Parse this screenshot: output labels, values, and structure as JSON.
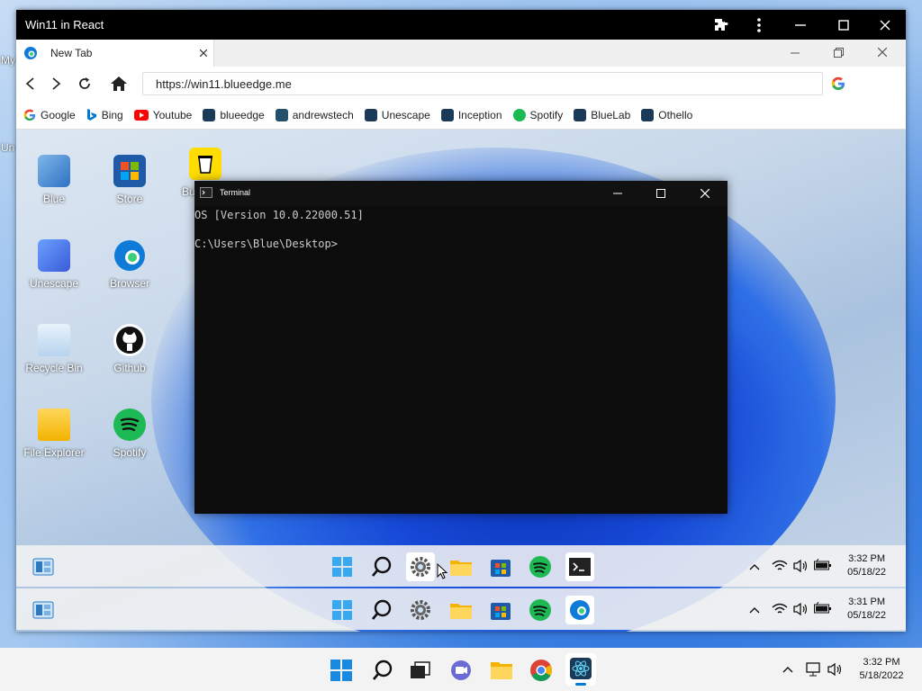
{
  "outer_desktop": {
    "side_labels": [
      "My",
      "Un"
    ]
  },
  "browser": {
    "window_title": "Win11 in React",
    "tab": {
      "label": "New Tab"
    },
    "url": "https://win11.blueedge.me",
    "bookmarks": [
      {
        "label": "Google",
        "color": "#4285F4"
      },
      {
        "label": "Bing",
        "color": "#0078D4"
      },
      {
        "label": "Youtube",
        "color": "#FF0000"
      },
      {
        "label": "blueedge",
        "color": "#1b3a57"
      },
      {
        "label": "andrewstech",
        "color": "#24506b"
      },
      {
        "label": "Unescape",
        "color": "#1b3a57"
      },
      {
        "label": "Inception",
        "color": "#1b3a57"
      },
      {
        "label": "Spotify",
        "color": "#1DB954"
      },
      {
        "label": "BlueLab",
        "color": "#1b3a57"
      },
      {
        "label": "Othello",
        "color": "#1b3a57"
      }
    ]
  },
  "inner_desktop": {
    "icons": [
      {
        "label": "Blue",
        "icon": "user-pc-icon"
      },
      {
        "label": "Store",
        "icon": "store-icon"
      },
      {
        "label": "Bu",
        "icon": "coffee-icon"
      },
      {
        "label": "Unescape",
        "icon": "unescape-icon"
      },
      {
        "label": "Browser",
        "icon": "edge-icon"
      },
      {
        "label": "Recycle Bin",
        "icon": "recycle-bin-icon"
      },
      {
        "label": "Github",
        "icon": "github-icon"
      },
      {
        "label": "File Explorer",
        "icon": "folder-icon"
      },
      {
        "label": "Spotify",
        "icon": "spotify-icon"
      }
    ]
  },
  "terminal": {
    "title": "Terminal",
    "lines": [
      "OS [Version 10.0.22000.51]",
      "",
      "C:\\Users\\Blue\\Desktop>"
    ]
  },
  "inner_taskbar_1": {
    "time": "3:32 PM",
    "date": "05/18/22"
  },
  "inner_taskbar_2": {
    "time": "3:31 PM",
    "date": "05/18/22"
  },
  "main_taskbar": {
    "time": "3:32 PM",
    "date": "5/18/2022"
  },
  "colors": {
    "accent": "#0078D4",
    "spotify": "#1DB954",
    "edge": "#0f7bd8"
  }
}
